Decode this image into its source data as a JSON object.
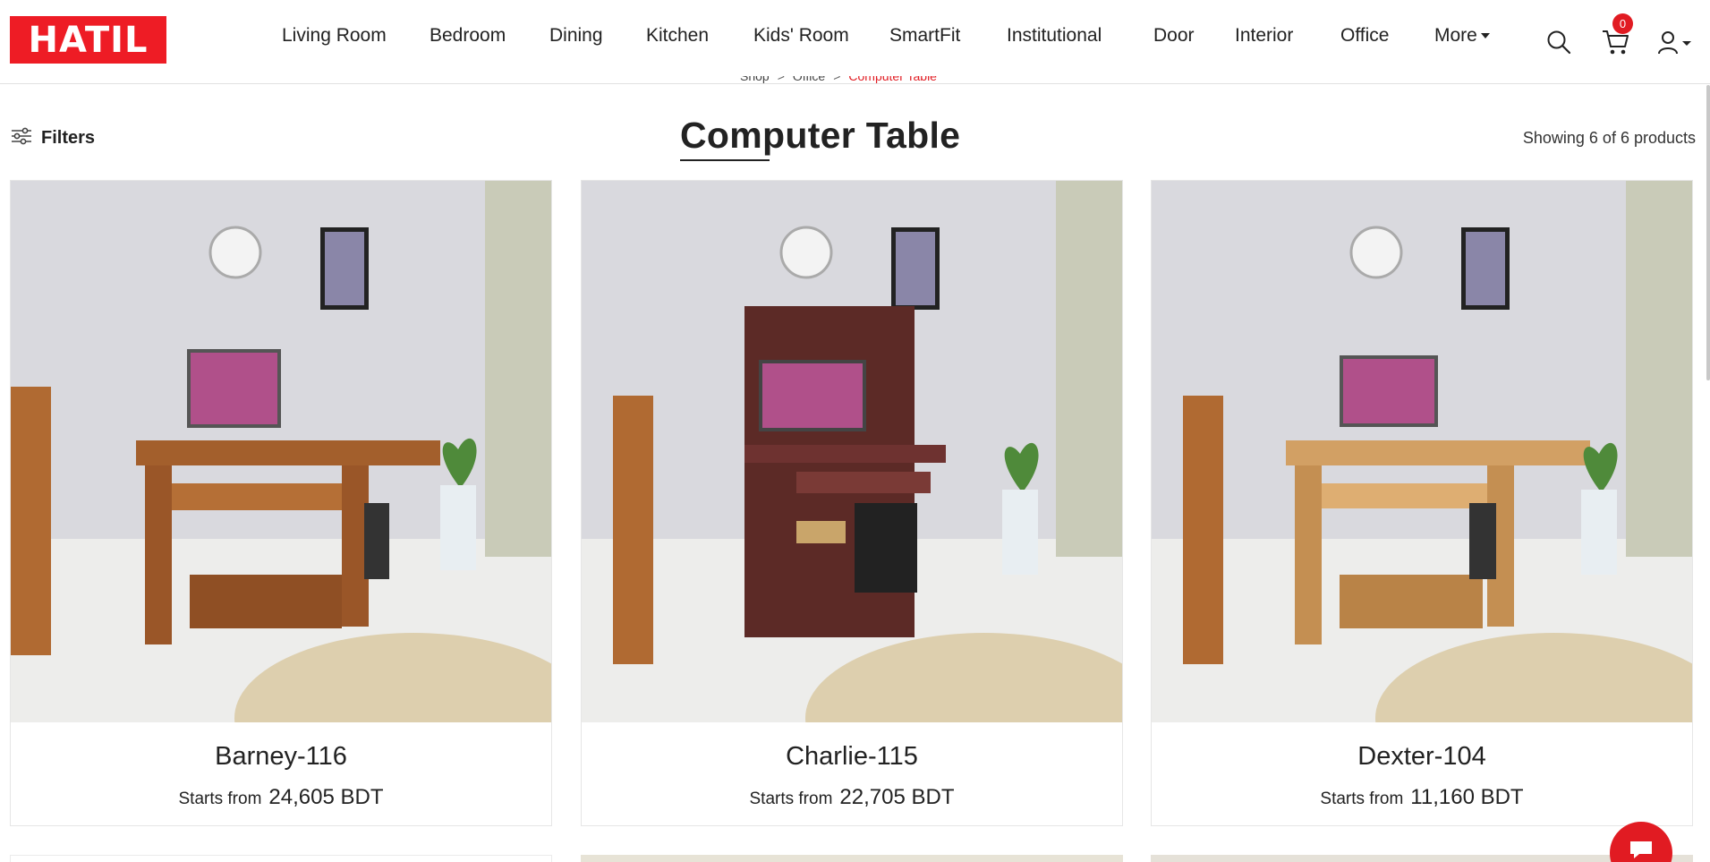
{
  "brand": {
    "logo_text": "HATIL",
    "logo_color": "#ee1c25"
  },
  "nav": {
    "items": [
      {
        "label": "Living Room"
      },
      {
        "label": "Bedroom"
      },
      {
        "label": "Dining"
      },
      {
        "label": "Kitchen"
      },
      {
        "label": "Kids' Room"
      },
      {
        "label": "SmartFit"
      },
      {
        "label": "Institutional"
      },
      {
        "label": "Door"
      },
      {
        "label": "Interior"
      },
      {
        "label": "Office"
      }
    ],
    "more_label": "More"
  },
  "header_icons": {
    "search": "search-icon",
    "cart": "cart-icon",
    "user": "user-icon"
  },
  "cart": {
    "count": "0"
  },
  "breadcrumb": {
    "items": [
      "Shop",
      "Office"
    ],
    "separator": ">",
    "current": "Computer Table"
  },
  "filters": {
    "label": "Filters",
    "icon": "sliders-icon"
  },
  "page": {
    "title": "Computer Table",
    "showing": "Showing 6 of 6 products"
  },
  "products": [
    {
      "name": "Barney-116",
      "starts_label": "Starts from",
      "price": "24,605 BDT",
      "finish": "walnut brown"
    },
    {
      "name": "Charlie-115",
      "starts_label": "Starts from",
      "price": "22,705 BDT",
      "finish": "mahogany"
    },
    {
      "name": "Dexter-104",
      "starts_label": "Starts from",
      "price": "11,160 BDT",
      "finish": "light oak"
    }
  ],
  "chat": {
    "icon": "chat-icon"
  },
  "colors": {
    "accent": "#e11b22",
    "text": "#222222",
    "border": "#e6e6e6"
  }
}
